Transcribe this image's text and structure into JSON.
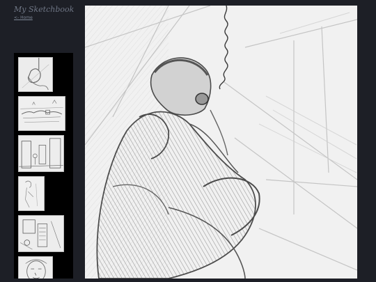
{
  "header": {
    "site_title": "My Sketchbook",
    "home_link": "<- Home"
  },
  "thumbnails": [
    {
      "name": "thumb-figure-hanging"
    },
    {
      "name": "thumb-landscape"
    },
    {
      "name": "thumb-street-scene"
    },
    {
      "name": "thumb-figure-study"
    },
    {
      "name": "thumb-interior"
    },
    {
      "name": "thumb-portrait"
    }
  ],
  "main_image": {
    "alt": ""
  }
}
